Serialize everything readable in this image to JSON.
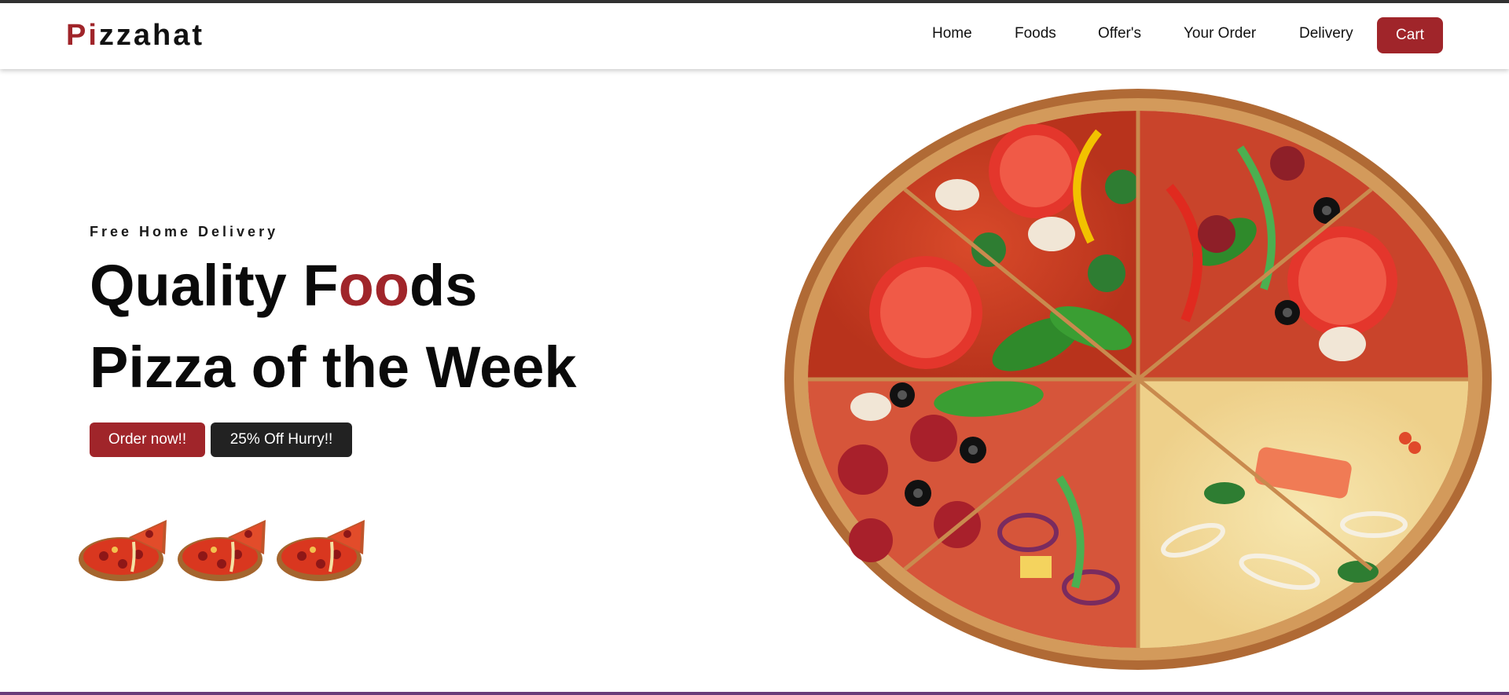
{
  "brand": {
    "logo_part1": "Pi",
    "logo_part2": "zzahat",
    "accent_color": "#a0252a"
  },
  "nav": {
    "items": [
      "Home",
      "Foods",
      "Offer's",
      "Your Order",
      "Delivery"
    ],
    "cart_label": "Cart"
  },
  "hero": {
    "tagline": "Free Home Delivery",
    "headline_part1": "Quality F",
    "headline_highlight": "oo",
    "headline_part2": "ds",
    "subheadline": "Pizza of the Week",
    "order_button": "Order now!!",
    "offer_button": "25% Off Hurry!!"
  },
  "images": {
    "mini_pizza_icons": [
      "pizza-slice-icon",
      "pizza-slice-icon",
      "pizza-slice-icon"
    ],
    "hero_image": "mixed-pizza-image"
  },
  "colors": {
    "primary_red": "#a0252a",
    "dark_button": "#222222",
    "top_strip": "#333333",
    "bottom_strip": "#6a3d7a"
  }
}
